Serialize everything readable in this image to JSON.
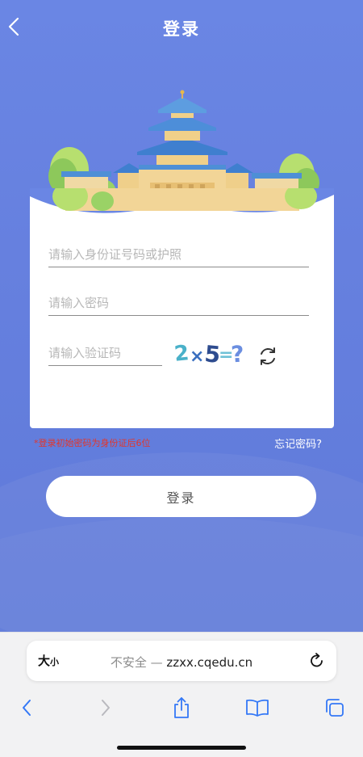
{
  "header": {
    "title": "登录"
  },
  "form": {
    "id_placeholder": "请输入身份证号码或护照",
    "password_placeholder": "请输入密码",
    "captcha_placeholder": "请输入验证码",
    "captcha_text": "2×5=?"
  },
  "notice": "*登录初始密码为身份证后6位",
  "forgot_password": "忘记密码?",
  "login_button": "登录",
  "browser": {
    "text_size_big": "大",
    "text_size_small": "小",
    "insecure_label": "不安全 — ",
    "domain": "zzxx.cqedu.cn"
  },
  "colors": {
    "background": "#6680df",
    "card": "#ffffff",
    "notice": "#e2362b",
    "toolbar_icon": "#3478f6"
  }
}
